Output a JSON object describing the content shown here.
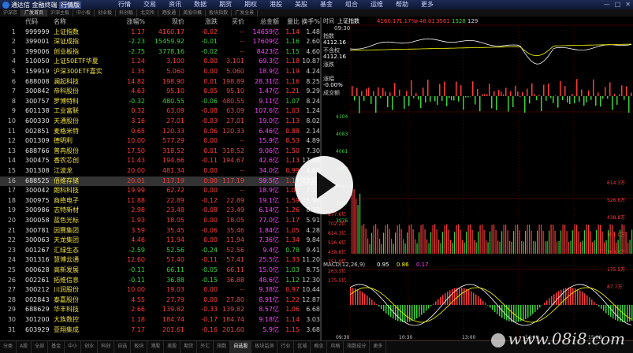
{
  "app": {
    "title": "通达信 金融终端",
    "version_badge": "行情版"
  },
  "menu": [
    "行情",
    "交易",
    "资讯",
    "数据",
    "期货",
    "期权",
    "港股",
    "美股",
    "基金",
    "组合",
    "运维",
    "帮助",
    "更多"
  ],
  "window_controls": {
    "min": "—",
    "max": "□",
    "close": "✕"
  },
  "tabs": [
    "沪深京",
    "广发首页",
    "沪深主板",
    "中小板",
    "创业板",
    "科创板",
    "北交所",
    "港股通",
    "美股中概",
    "板块指数",
    "广发全景"
  ],
  "columns": {
    "idx": "",
    "code": "代码",
    "name": "名称",
    "pct": "涨幅%",
    "price": "现价",
    "chg": "涨跌",
    "bid": "买价",
    "amt": "总金额",
    "vr": "量比",
    "tr": "换手%"
  },
  "rows": [
    {
      "idx": "1",
      "code": "999999",
      "name": "上证指数",
      "pct": "1.17",
      "price": "4160.17",
      "chg": "-0.02",
      "bid": "--",
      "amt": "14659亿",
      "vr": "1.14",
      "tr": "1.48",
      "dir": "up"
    },
    {
      "idx": "2",
      "code": "399001",
      "name": "深证成指",
      "pct": "-2.23",
      "price": "15459.92",
      "chg": "-0.01",
      "bid": "--",
      "amt": "17609亿",
      "vr": "1.16",
      "tr": "2.60",
      "dir": "dn"
    },
    {
      "idx": "3",
      "code": "399006",
      "name": "创业板指",
      "pct": "-2.75",
      "price": "3778.16",
      "chg": "-0.02",
      "bid": "--",
      "amt": "8423亿",
      "vr": "1.15",
      "tr": "4.60",
      "dir": "dn"
    },
    {
      "idx": "4",
      "code": "510050",
      "name": "上证50ETF华夏",
      "pct": "1.24",
      "price": "3.100",
      "chg": "0.00",
      "bid": "3.101",
      "amt": "69.3亿",
      "vr": "1.18",
      "tr": "10.87",
      "dir": "up"
    },
    {
      "idx": "5",
      "code": "159919",
      "name": "沪深300ETF嘉实",
      "pct": "1.35",
      "price": "5.060",
      "chg": "0.00",
      "bid": "5.060",
      "amt": "18.9亿",
      "vr": "1.19",
      "tr": "4.24",
      "dir": "up"
    },
    {
      "idx": "6",
      "code": "688008",
      "name": "澜起科技",
      "pct": "14.82",
      "price": "198.90",
      "chg": "0.01",
      "bid": "198.89",
      "amt": "28.31亿",
      "vr": "1.16",
      "tr": "8.25",
      "dir": "up"
    },
    {
      "idx": "7",
      "code": "300842",
      "name": "帝科股份",
      "pct": "4.63",
      "price": "95.10",
      "chg": "0.05",
      "bid": "95.10",
      "amt": "1.47亿",
      "vr": "1.21",
      "tr": "9.29",
      "dir": "up"
    },
    {
      "idx": "8",
      "code": "300757",
      "name": "罗博特科",
      "pct": "-0.32",
      "price": "480.55",
      "chg": "-0.06",
      "bid": "480.55",
      "amt": "9.11亿",
      "vr": "1.07",
      "tr": "8.24",
      "dir": "dn"
    },
    {
      "idx": "9",
      "code": "601138",
      "name": "工业富联",
      "pct": "0.32",
      "price": "63.09",
      "chg": "-0.08",
      "bid": "63.09",
      "amt": "107.6亿",
      "vr": "1.03",
      "tr": "1.24",
      "dir": "up"
    },
    {
      "idx": "10",
      "code": "600330",
      "name": "天通股份",
      "pct": "3.16",
      "price": "27.01",
      "chg": "-0.03",
      "bid": "27.01",
      "amt": "19.0亿",
      "vr": "1.13",
      "tr": "8.02",
      "dir": "up"
    },
    {
      "idx": "11",
      "code": "002851",
      "name": "麦格米特",
      "pct": "0.65",
      "price": "120.33",
      "chg": "0.06",
      "bid": "120.33",
      "amt": "6.46亿",
      "vr": "0.88",
      "tr": "2.14",
      "dir": "up"
    },
    {
      "idx": "12",
      "code": "001309",
      "name": "德明利",
      "pct": "10.00",
      "price": "577.29",
      "chg": "0.00",
      "bid": "--",
      "amt": "15.9亿",
      "vr": "0.53",
      "tr": "4.89",
      "dir": "up"
    },
    {
      "idx": "13",
      "code": "688766",
      "name": "普冉股份",
      "pct": "17.50",
      "price": "318.52",
      "chg": "0.01",
      "bid": "318.52",
      "amt": "9.06亿",
      "vr": "1.50",
      "tr": "7.30",
      "dir": "up"
    },
    {
      "idx": "14",
      "code": "300475",
      "name": "香农芯创",
      "pct": "11.43",
      "price": "194.66",
      "chg": "-0.11",
      "bid": "194.67",
      "amt": "42.6亿",
      "vr": "1.13",
      "tr": "17.64",
      "dir": "up"
    },
    {
      "idx": "15",
      "code": "301308",
      "name": "江波龙",
      "pct": "20.00",
      "price": "481.34",
      "chg": "0.00",
      "bid": "--",
      "amt": "34.0亿",
      "vr": "0.99",
      "tr": "4.60",
      "dir": "up"
    },
    {
      "idx": "16",
      "code": "688525",
      "name": "佰维存储",
      "pct": "20.01",
      "price": "117.19",
      "chg": "0.00",
      "bid": "117.19",
      "amt": "59.5亿",
      "vr": "1.11",
      "tr": "12.67",
      "dir": "up",
      "selected": true
    },
    {
      "idx": "17",
      "code": "300042",
      "name": "朗科科技",
      "pct": "19.99",
      "price": "62.72",
      "chg": "0.00",
      "bid": "--",
      "amt": "18.9亿",
      "vr": "1.04",
      "tr": "7.12",
      "dir": "up"
    },
    {
      "idx": "18",
      "code": "300975",
      "name": "商络电子",
      "pct": "11.88",
      "price": "22.89",
      "chg": "-0.12",
      "bid": "22.89",
      "amt": "19.1亿",
      "vr": "1.59",
      "tr": "15.96",
      "dir": "up"
    },
    {
      "idx": "19",
      "code": "300986",
      "name": "志特新材",
      "pct": "2.98",
      "price": "23.48",
      "chg": "-0.08",
      "bid": "23.49",
      "amt": "6.14亿",
      "vr": "1.26",
      "tr": "8.33",
      "dir": "up"
    },
    {
      "idx": "20",
      "code": "300058",
      "name": "蓝色光标",
      "pct": "1.93",
      "price": "18.05",
      "chg": "0.00",
      "bid": "18.05",
      "amt": "77.0亿",
      "vr": "1.17",
      "tr": "5.91",
      "dir": "up"
    },
    {
      "idx": "21",
      "code": "300781",
      "name": "因赛集团",
      "pct": "3.59",
      "price": "35.45",
      "chg": "-0.06",
      "bid": "35.46",
      "amt": "1.84亿",
      "vr": "1.05",
      "tr": "4.28",
      "dir": "up"
    },
    {
      "idx": "22",
      "code": "300063",
      "name": "天龙集团",
      "pct": "4.46",
      "price": "11.94",
      "chg": "0.00",
      "bid": "11.94",
      "amt": "7.36亿",
      "vr": "1.34",
      "tr": "9.84",
      "dir": "up"
    },
    {
      "idx": "23",
      "code": "001267",
      "name": "汇绿生态",
      "pct": "-2.59",
      "price": "52.56",
      "chg": "-0.24",
      "bid": "52.56",
      "amt": "9.4亿",
      "vr": "0.78",
      "tr": "9.41",
      "dir": "dn"
    },
    {
      "idx": "24",
      "code": "301316",
      "name": "慧博云通",
      "pct": "12.60",
      "price": "57.40",
      "chg": "-0.11",
      "bid": "57.41",
      "amt": "25.5亿",
      "vr": "1.33",
      "tr": "11.20",
      "dir": "up"
    },
    {
      "idx": "25",
      "code": "000628",
      "name": "高新发展",
      "pct": "-0.11",
      "price": "66.11",
      "chg": "-0.05",
      "bid": "66.11",
      "amt": "15.0亿",
      "vr": "1.03",
      "tr": "8.75",
      "dir": "dn"
    },
    {
      "idx": "26",
      "code": "002261",
      "name": "拓维信息",
      "pct": "-0.11",
      "price": "36.88",
      "chg": "-0.15",
      "bid": "36.88",
      "amt": "48.6亿",
      "vr": "1.12",
      "tr": "12.30",
      "dir": "dn"
    },
    {
      "idx": "27",
      "code": "300212",
      "name": "川润股份",
      "pct": "10.00",
      "price": "19.03",
      "chg": "0.00",
      "bid": "--",
      "amt": "9.38亿",
      "vr": "0.97",
      "tr": "10.44",
      "dir": "up"
    },
    {
      "idx": "28",
      "code": "002843",
      "name": "泰嘉股份",
      "pct": "4.55",
      "price": "27.79",
      "chg": "0.00",
      "bid": "27.80",
      "amt": "8.91亿",
      "vr": "1.22",
      "tr": "12.87",
      "dir": "up"
    },
    {
      "idx": "29",
      "code": "688629",
      "name": "华丰科技",
      "pct": "2.66",
      "price": "139.82",
      "chg": "-0.33",
      "bid": "139.82",
      "amt": "8.57亿",
      "vr": "1.06",
      "tr": "6.68",
      "dir": "up"
    },
    {
      "idx": "30",
      "code": "301200",
      "name": "大族数控",
      "pct": "1.18",
      "price": "184.74",
      "chg": "-0.17",
      "bid": "184.74",
      "amt": "9.18亿",
      "vr": "1.14",
      "tr": "3.03",
      "dir": "up"
    },
    {
      "idx": "31",
      "code": "603929",
      "name": "亚翔集成",
      "pct": "7.17",
      "price": "201.61",
      "chg": "-0.16",
      "bid": "201.60",
      "amt": "5.9亿",
      "vr": "1.15",
      "tr": "3.68",
      "dir": "up"
    }
  ],
  "chart": {
    "header": {
      "label": "时间",
      "index_name": "上证指数",
      "value": "4160.17",
      "pct": "1.17%",
      "diff": "+48.01",
      "up": "3561",
      "down": "1528",
      "even": "129"
    },
    "left_panel": {
      "time": "09:30",
      "price_label": "指数",
      "price_value": "4112.16",
      "no_chg_label": "不含权",
      "no_chg_value": "4112.16",
      "chg_label": "涨跌",
      "chg_value": "-0.00%",
      "amp_label": "涨幅",
      "amp_value": "-0.00%",
      "vol_label": "成交额"
    },
    "price_ticks": [
      "4104",
      "4083",
      "4061",
      "4040",
      "4019",
      "3997",
      "3976"
    ],
    "vol_ticks": [
      "877.6亿",
      "702.2亿",
      "614.3亿",
      "526.6亿",
      "438.8亿",
      "351.0亿",
      "263.3亿",
      "175.5亿"
    ],
    "right_ticks": [
      "614.3万",
      "526.6万",
      "438.8万",
      "351.0万",
      "263.3万",
      "175.5万",
      "87.7万"
    ],
    "macd_label": "MACD(12,26,9)",
    "macd_values": {
      "dif": "0.95",
      "dea": "0.86",
      "macd": "0.17"
    },
    "time_ticks": [
      "09:30",
      "10:30",
      "13:00",
      "14:00",
      "15:00"
    ]
  },
  "bottom_tabs": [
    "分类",
    "A股",
    "全部",
    "基金",
    "中小",
    "创业",
    "科创",
    "自选",
    "板块",
    "港股",
    "美股",
    "期货",
    "外汇",
    "指数",
    "自选股",
    "板块监测",
    "行业",
    "区域",
    "概念",
    "风格",
    "指数成分",
    "更多"
  ],
  "watermark": "www.08i8.com",
  "colors": {
    "up": "#ff3b3b",
    "down": "#3bd23b",
    "volume": "#ff44ff",
    "name": "#f0e040",
    "index_line": "#ffffff",
    "avg_line": "#ffff00"
  }
}
